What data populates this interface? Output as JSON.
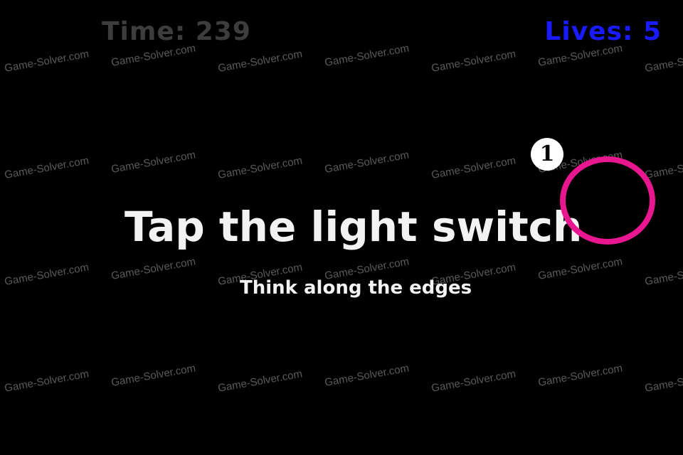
{
  "hud": {
    "time_label": "Time: 239",
    "lives_label": "Lives: 5",
    "time_color": "#3d3d3d",
    "lives_color": "#1a1aff"
  },
  "puzzle": {
    "title": "Tap the light switch",
    "hint": "Think along the edges"
  },
  "solution_marker": {
    "step_number": "1",
    "ring_color": "#e8168f"
  },
  "watermark": {
    "text": "Game-Solver.com"
  }
}
